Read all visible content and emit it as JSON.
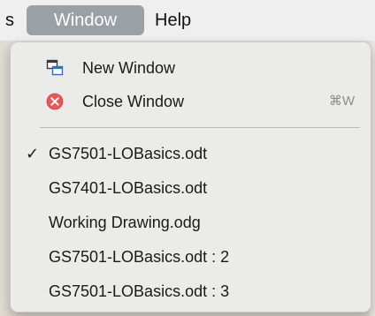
{
  "menubar": {
    "partial_item": "s",
    "active_item": "Window",
    "help_item": "Help"
  },
  "menu": {
    "new_window": {
      "label": "New Window",
      "icon": "new-window-icon"
    },
    "close_window": {
      "label": "Close Window",
      "shortcut": "⌘W",
      "icon": "close-circle-icon",
      "icon_color": "#e8585a"
    },
    "windows": [
      {
        "label": "GS7501-LOBasics.odt",
        "checked": true
      },
      {
        "label": "GS7401-LOBasics.odt",
        "checked": false
      },
      {
        "label": "Working Drawing.odg",
        "checked": false
      },
      {
        "label": "GS7501-LOBasics.odt : 2",
        "checked": false
      },
      {
        "label": "GS7501-LOBasics.odt : 3",
        "checked": false
      }
    ],
    "check_mark": "✓"
  },
  "colors": {
    "accent_icon": "#3a7bd5",
    "menu_bg": "#ebebea",
    "active_menubar_bg": "#9aa0a6"
  }
}
